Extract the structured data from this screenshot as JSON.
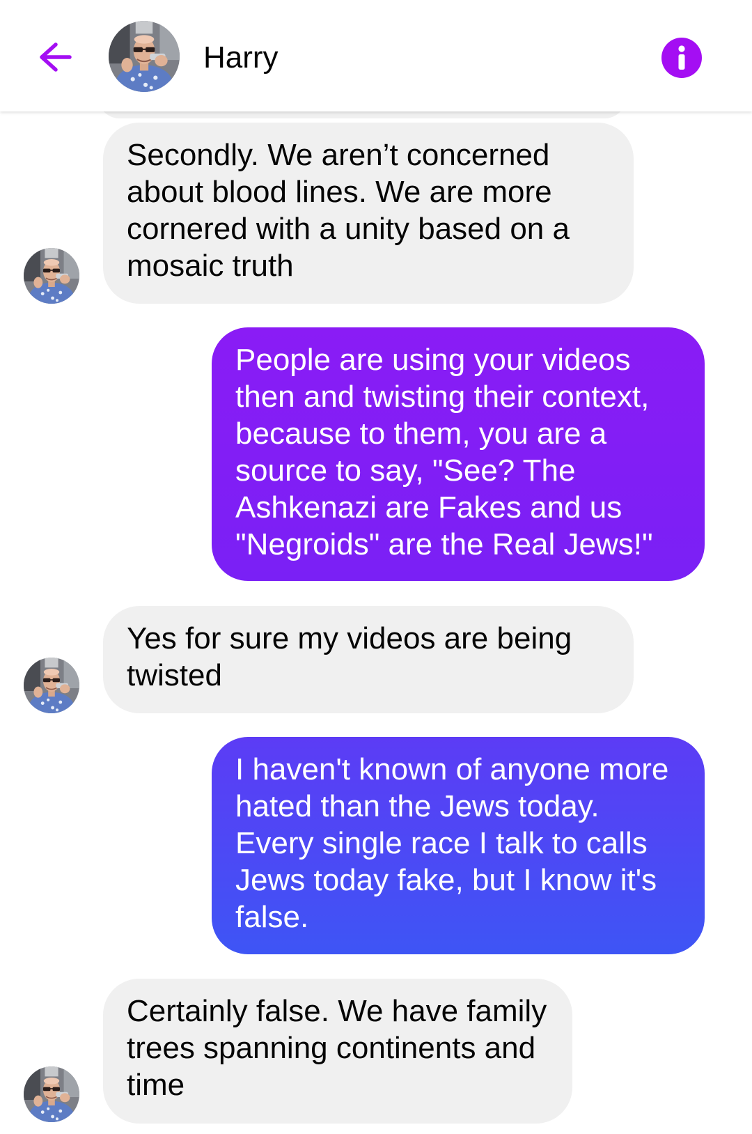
{
  "header": {
    "contact_name": "Harry",
    "back_icon": "arrow-left-icon",
    "info_icon": "info-icon",
    "accent_color": "#a40ef3"
  },
  "messages": [
    {
      "direction": "incoming",
      "text": "Secondly. We aren’t concerned about blood lines. We are more cornered with a unity based on a mosaic truth"
    },
    {
      "direction": "outgoing",
      "text": "People are using your videos then and twisting their context, because to them, you are a source to say, \"See? The Ashkenazi are Fakes and us \"Negroids\" are the Real Jews!\""
    },
    {
      "direction": "incoming",
      "text": "Yes for sure my videos are being twisted"
    },
    {
      "direction": "outgoing",
      "text": "I haven't known of anyone more hated than the Jews today. Every single race I talk to calls Jews today fake, but I know it's false."
    },
    {
      "direction": "incoming",
      "text": "Certainly false. We have family trees spanning continents and time"
    }
  ],
  "colors": {
    "incoming_bubble": "#f0f0f0",
    "outgoing_gradient_top": "#8a1cf5",
    "outgoing_gradient_mid": "#6a2df5",
    "outgoing_gradient_bottom": "#3e55f5"
  }
}
